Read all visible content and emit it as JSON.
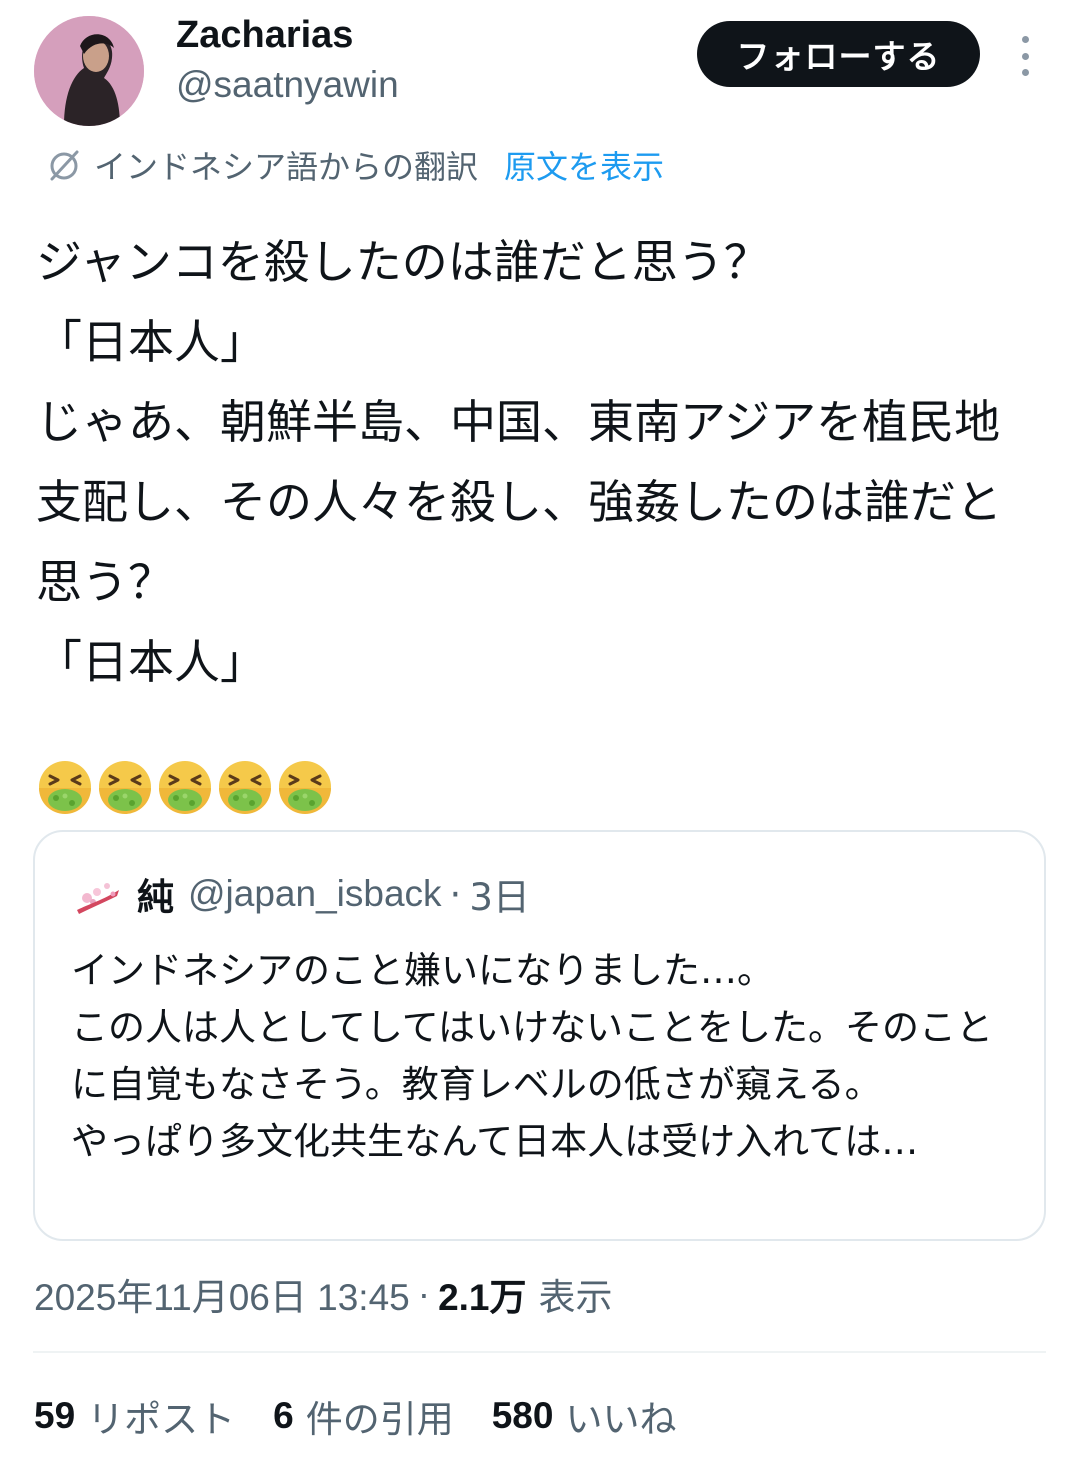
{
  "author": {
    "display_name": "Zacharias",
    "handle": "@saatnyawin",
    "follow_label": "フォローする"
  },
  "translation": {
    "note": "インドネシア語からの翻訳",
    "show_original": "原文を表示"
  },
  "tweet": {
    "text": "ジャンコを殺したのは誰だと思う？\n「日本人」\nじゃあ、朝鮮半島、中国、東南アジアを植民地支配し、その人々を殺し、強姦したのは誰だと思う？\n「日本人」",
    "emoji_icon": "nauseated-face-emoji",
    "emoji_count": 5
  },
  "quote": {
    "name": "純",
    "handle": "@japan_isback",
    "separator": "·",
    "time": "3日",
    "text": "インドネシアのこと嫌いになりました…。\nこの人は人としてしてはいけないことをした。そのことに自覚もなさそう。教育レベルの低さが窺える。\nやっぱり多文化共生なんて日本人は受け入れては…"
  },
  "meta": {
    "timestamp": "2025年11月06日 13:45",
    "separator": "·",
    "views_count": "2.1万",
    "views_label": "表示"
  },
  "stats": {
    "reposts_count": "59",
    "reposts_label": "リポスト",
    "quotes_count": "6",
    "quotes_label": "件の引用",
    "likes_count": "580",
    "likes_label": "いいね"
  },
  "colors": {
    "link": "#1d9bf0",
    "secondary_text": "#536471",
    "follow_button_bg": "#0f1419"
  }
}
